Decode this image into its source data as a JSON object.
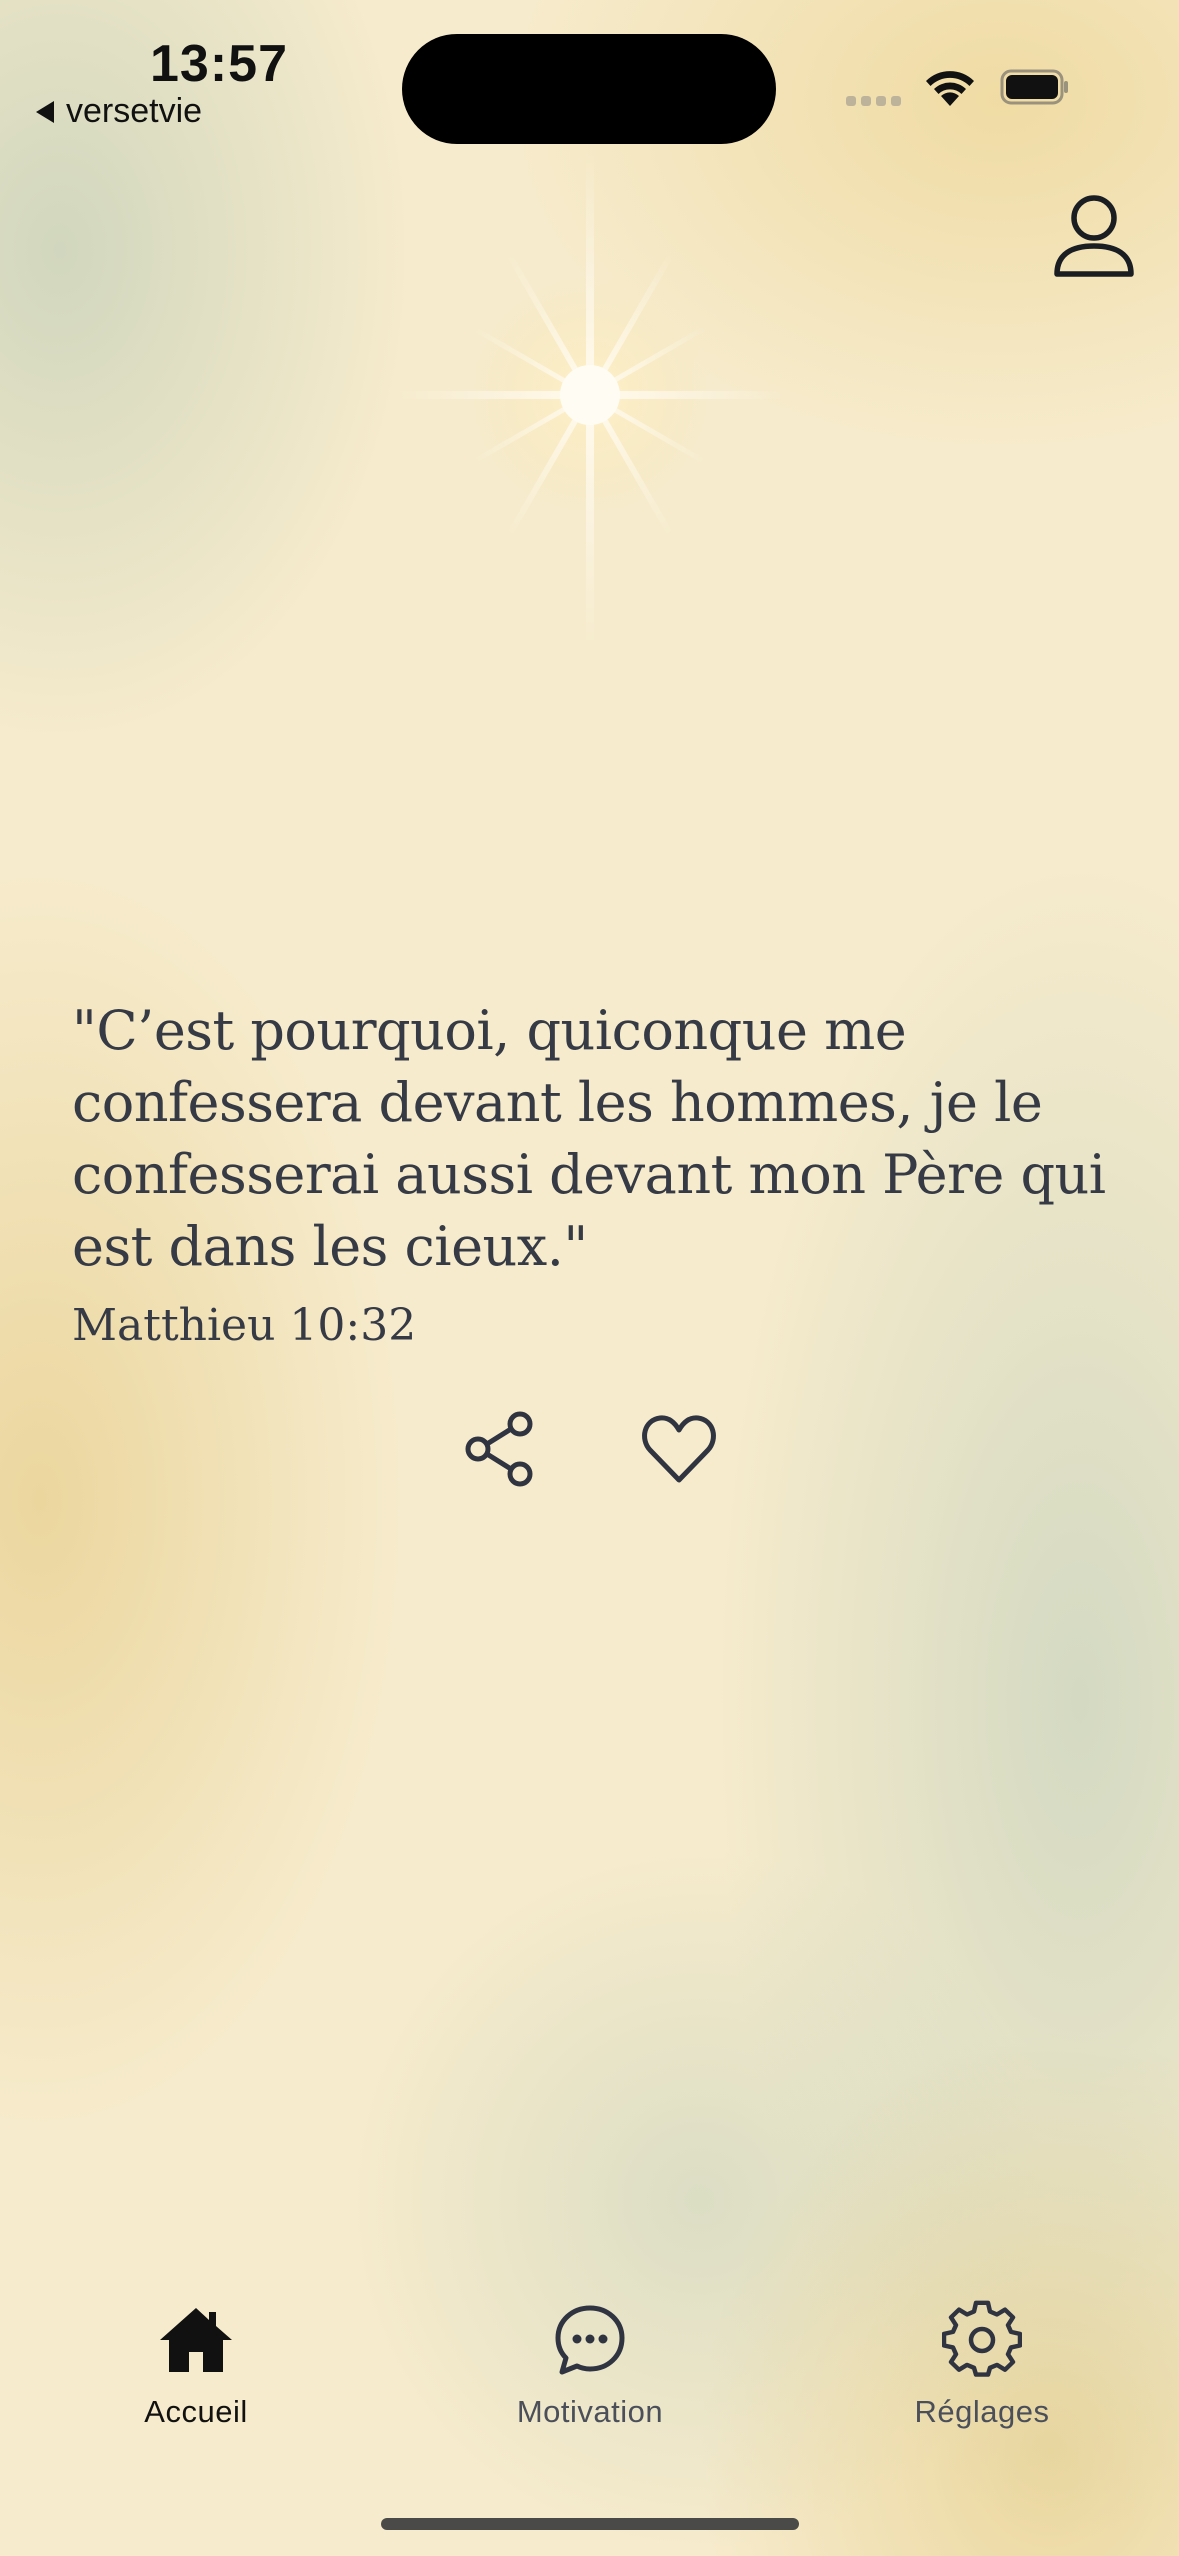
{
  "status_bar": {
    "time": "13:57",
    "back_app": "versetvie"
  },
  "verse": {
    "text": "\"C’est pourquoi, quiconque me confessera devant les hommes, je le confesserai aussi devant mon Père qui est dans les cieux.\"",
    "reference": "Matthieu 10:32"
  },
  "tabs": [
    {
      "label": "Accueil",
      "icon": "home-icon",
      "active": true
    },
    {
      "label": "Motivation",
      "icon": "chat-bubble-icon",
      "active": false
    },
    {
      "label": "Réglages",
      "icon": "gear-icon",
      "active": false
    }
  ],
  "colors": {
    "background": "#f6ebcc",
    "text": "#353a45",
    "active_tab": "#111111"
  }
}
